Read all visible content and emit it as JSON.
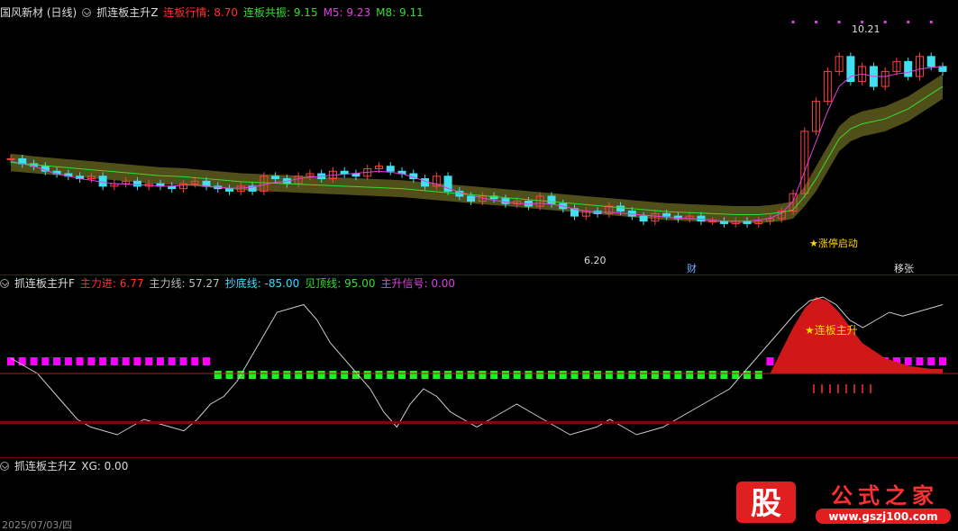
{
  "panel1": {
    "stock": "国风新材 (日线)",
    "indicator": "抓连板主升Z",
    "items": [
      {
        "label": "连板行情: 8.70",
        "color": "#ff3030"
      },
      {
        "label": "连板共振: 9.15",
        "color": "#33dd33"
      },
      {
        "label": "M5: 9.23",
        "color": "#e040e0"
      },
      {
        "label": "M8: 9.11",
        "color": "#33dd33"
      }
    ],
    "high_label": "10.21",
    "low_label": "6.20",
    "start_label": "★涨停启动",
    "badge_cai": "财",
    "badge_jc": "移张"
  },
  "panel2": {
    "indicator": "抓连板主升F",
    "items": [
      {
        "label": "主力进: 6.77",
        "color": "#ff3030"
      },
      {
        "label": "主力线: 57.27",
        "color": "#bbbbbb"
      },
      {
        "label": "抄底线: -85.00",
        "color": "#30e0ff"
      },
      {
        "label": "见顶线: 95.00",
        "color": "#33dd33"
      },
      {
        "label": "主升信号: 0.00",
        "color": "#e040e0"
      }
    ],
    "signal_label": "★连板主升"
  },
  "panel3": {
    "indicator": "抓连板主升Z",
    "xg": "XG: 0.00"
  },
  "date_label": "2025/07/03/四",
  "watermark": "公式之家",
  "watermark_url": "www.gszj100.com",
  "logo_char": "股",
  "chart_data": {
    "type": "candlestick",
    "price_range": [
      5.8,
      10.6
    ],
    "closes": [
      7.85,
      7.75,
      7.7,
      7.6,
      7.55,
      7.5,
      7.45,
      7.5,
      7.3,
      7.35,
      7.4,
      7.3,
      7.35,
      7.3,
      7.25,
      7.35,
      7.4,
      7.3,
      7.25,
      7.2,
      7.3,
      7.2,
      7.5,
      7.45,
      7.35,
      7.5,
      7.55,
      7.45,
      7.6,
      7.55,
      7.5,
      7.65,
      7.7,
      7.6,
      7.55,
      7.45,
      7.3,
      7.5,
      7.2,
      7.1,
      7.0,
      7.1,
      7.05,
      6.95,
      7.0,
      6.9,
      7.1,
      6.95,
      6.85,
      6.7,
      6.8,
      6.75,
      6.9,
      6.8,
      6.7,
      6.6,
      6.75,
      6.7,
      6.65,
      6.7,
      6.6,
      6.6,
      6.55,
      6.6,
      6.55,
      6.6,
      6.65,
      6.8,
      7.15,
      8.4,
      9.0,
      9.6,
      9.9,
      9.4,
      9.7,
      9.3,
      9.6,
      9.8,
      9.5,
      9.9,
      9.7,
      9.6
    ],
    "ma5": [
      7.8,
      7.75,
      7.7,
      7.62,
      7.55,
      7.5,
      7.45,
      7.42,
      7.38,
      7.35,
      7.34,
      7.33,
      7.32,
      7.3,
      7.3,
      7.32,
      7.33,
      7.3,
      7.28,
      7.26,
      7.26,
      7.28,
      7.33,
      7.38,
      7.4,
      7.45,
      7.48,
      7.5,
      7.52,
      7.54,
      7.56,
      7.58,
      7.6,
      7.58,
      7.55,
      7.48,
      7.4,
      7.34,
      7.26,
      7.18,
      7.12,
      7.06,
      7.02,
      6.98,
      6.96,
      6.94,
      6.96,
      6.94,
      6.9,
      6.84,
      6.8,
      6.78,
      6.78,
      6.76,
      6.74,
      6.72,
      6.7,
      6.68,
      6.66,
      6.65,
      6.64,
      6.62,
      6.6,
      6.6,
      6.6,
      6.62,
      6.66,
      6.76,
      7.0,
      7.6,
      8.2,
      8.8,
      9.3,
      9.5,
      9.55,
      9.5,
      9.5,
      9.55,
      9.58,
      9.65,
      9.68,
      9.7
    ],
    "band_top": [
      7.95,
      7.93,
      7.9,
      7.88,
      7.86,
      7.84,
      7.82,
      7.8,
      7.78,
      7.76,
      7.74,
      7.72,
      7.7,
      7.68,
      7.67,
      7.66,
      7.64,
      7.62,
      7.6,
      7.58,
      7.56,
      7.55,
      7.54,
      7.53,
      7.52,
      7.51,
      7.5,
      7.49,
      7.48,
      7.47,
      7.46,
      7.45,
      7.44,
      7.43,
      7.42,
      7.4,
      7.38,
      7.36,
      7.34,
      7.32,
      7.3,
      7.28,
      7.26,
      7.24,
      7.22,
      7.2,
      7.18,
      7.16,
      7.14,
      7.12,
      7.1,
      7.08,
      7.06,
      7.04,
      7.02,
      7.0,
      6.98,
      6.96,
      6.95,
      6.94,
      6.93,
      6.92,
      6.91,
      6.9,
      6.9,
      6.9,
      6.92,
      6.95,
      7.0,
      7.3,
      7.7,
      8.1,
      8.5,
      8.7,
      8.8,
      8.85,
      8.9,
      9.0,
      9.1,
      9.25,
      9.4,
      9.55
    ],
    "band_bottom": [
      7.6,
      7.58,
      7.56,
      7.54,
      7.52,
      7.5,
      7.48,
      7.46,
      7.44,
      7.42,
      7.4,
      7.38,
      7.36,
      7.34,
      7.33,
      7.32,
      7.3,
      7.28,
      7.26,
      7.24,
      7.22,
      7.21,
      7.2,
      7.19,
      7.18,
      7.17,
      7.16,
      7.15,
      7.14,
      7.13,
      7.12,
      7.11,
      7.1,
      7.09,
      7.08,
      7.06,
      7.04,
      7.02,
      7.0,
      6.98,
      6.96,
      6.94,
      6.92,
      6.9,
      6.88,
      6.86,
      6.84,
      6.82,
      6.8,
      6.78,
      6.76,
      6.74,
      6.72,
      6.7,
      6.68,
      6.66,
      6.64,
      6.62,
      6.61,
      6.6,
      6.59,
      6.58,
      6.57,
      6.56,
      6.56,
      6.56,
      6.58,
      6.6,
      6.65,
      6.9,
      7.2,
      7.6,
      8.0,
      8.2,
      8.3,
      8.35,
      8.4,
      8.5,
      8.6,
      8.75,
      8.9,
      9.05
    ],
    "main_line": [
      20,
      10,
      0,
      -20,
      -40,
      -60,
      -70,
      -75,
      -80,
      -70,
      -60,
      -65,
      -70,
      -75,
      -60,
      -40,
      -30,
      -10,
      20,
      50,
      80,
      85,
      90,
      70,
      40,
      20,
      0,
      -20,
      -50,
      -70,
      -40,
      -20,
      -30,
      -50,
      -60,
      -70,
      -60,
      -50,
      -40,
      -50,
      -60,
      -70,
      -80,
      -75,
      -70,
      -60,
      -70,
      -80,
      -75,
      -70,
      -60,
      -50,
      -40,
      -30,
      -20,
      0,
      20,
      40,
      60,
      80,
      95,
      100,
      90,
      70,
      60,
      70,
      80,
      75,
      80,
      85,
      90
    ]
  }
}
